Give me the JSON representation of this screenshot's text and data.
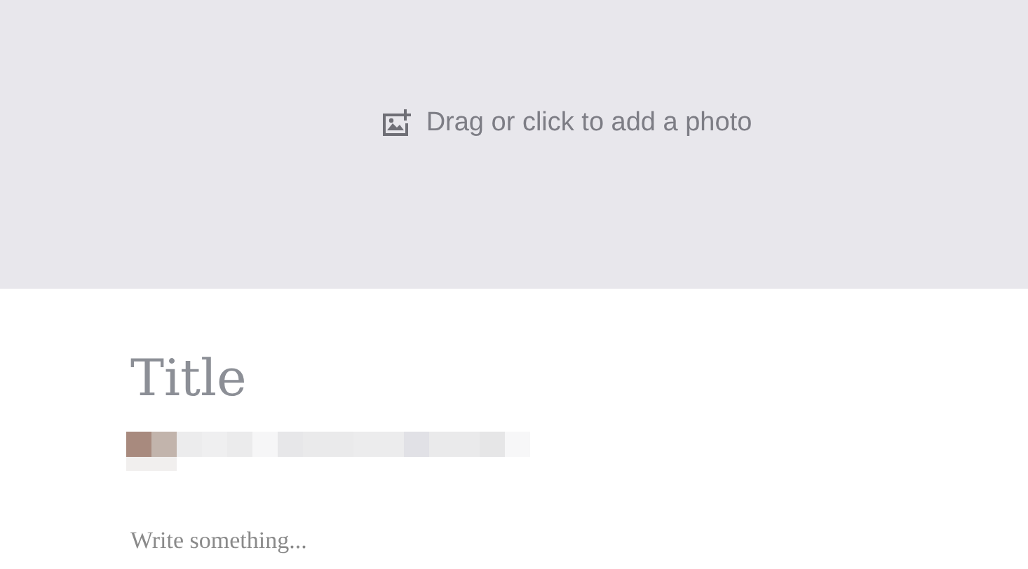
{
  "photo_upload": {
    "label": "Drag or click to add a photo"
  },
  "title": {
    "placeholder": "Title"
  },
  "body": {
    "placeholder": "Write something..."
  }
}
